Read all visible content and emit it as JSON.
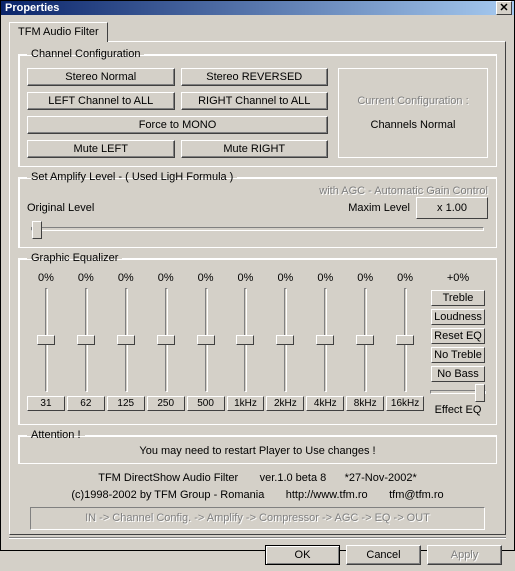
{
  "window": {
    "title": "Properties"
  },
  "tab": {
    "label": "TFM Audio Filter"
  },
  "channel": {
    "legend": "Channel Configuration",
    "buttons": {
      "stereo_normal": "Stereo Normal",
      "stereo_reversed": "Stereo REVERSED",
      "left_all": "LEFT Channel to ALL",
      "right_all": "RIGHT Channel to ALL",
      "force_mono": "Force to MONO",
      "mute_left": "Mute LEFT",
      "mute_right": "Mute RIGHT"
    },
    "current_label": "Current Configuration :",
    "current_value": "Channels Normal"
  },
  "amplify": {
    "legend": "Set Amplify Level     -     ( Used  LigH  Formula )",
    "agc": "with  AGC  -  Automatic Gain Control",
    "orig": "Original Level",
    "max": "Maxim Level",
    "value": "x 1.00"
  },
  "eq": {
    "legend": "Graphic Equalizer",
    "bands": [
      {
        "val": "0%",
        "label": "31"
      },
      {
        "val": "0%",
        "label": "62"
      },
      {
        "val": "0%",
        "label": "125"
      },
      {
        "val": "0%",
        "label": "250"
      },
      {
        "val": "0%",
        "label": "500"
      },
      {
        "val": "0%",
        "label": "1kHz"
      },
      {
        "val": "0%",
        "label": "2kHz"
      },
      {
        "val": "0%",
        "label": "4kHz"
      },
      {
        "val": "0%",
        "label": "8kHz"
      },
      {
        "val": "0%",
        "label": "16kHz"
      }
    ],
    "plus": "+0%",
    "btns": {
      "treble": "Treble",
      "loudness": "Loudness",
      "reset": "Reset EQ",
      "notreble": "No Treble",
      "nobass": "No Bass"
    },
    "effect": "Effect EQ"
  },
  "attention": {
    "legend": "Attention !",
    "text": "You may need to restart Player to Use changes !"
  },
  "info": {
    "line1a": "TFM DirectShow Audio Filter",
    "line1b": "ver.1.0 beta 8",
    "line1c": "*27-Nov-2002*",
    "line2a": "(c)1998-2002 by TFM Group - Romania",
    "line2b": "http://www.tfm.ro",
    "line2c": "tfm@tfm.ro",
    "chain": "IN -> Channel Config. -> Amplify -> Compressor -> AGC -> EQ -> OUT"
  },
  "dlg": {
    "ok": "OK",
    "cancel": "Cancel",
    "apply": "Apply"
  }
}
